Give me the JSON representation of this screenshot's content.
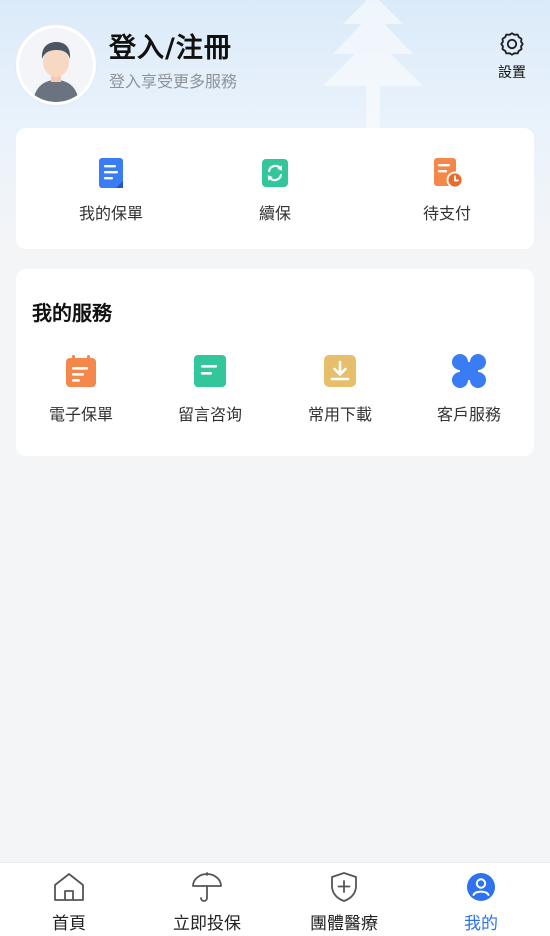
{
  "header": {
    "title": "登入/注冊",
    "subtitle": "登入享受更多服務",
    "settings_label": "設置",
    "settings_icon": "gear-icon",
    "avatar_icon": "avatar"
  },
  "quick_actions": [
    {
      "label": "我的保單",
      "icon": "document-icon",
      "color": "#3a7cf3"
    },
    {
      "label": "續保",
      "icon": "renew-icon",
      "color": "#33c59b"
    },
    {
      "label": "待支付",
      "icon": "pending-payment-icon",
      "color": "#f6874a"
    }
  ],
  "services": {
    "title": "我的服務",
    "items": [
      {
        "label": "電子保單",
        "icon": "e-policy-icon",
        "color": "#f6874a"
      },
      {
        "label": "留言咨询",
        "icon": "message-icon",
        "color": "#33c59b"
      },
      {
        "label": "常用下載",
        "icon": "download-icon",
        "color": "#e6be6c"
      },
      {
        "label": "客戶服務",
        "icon": "grid-icon",
        "color": "#3a7cf3"
      }
    ]
  },
  "tabbar": {
    "items": [
      {
        "label": "首頁",
        "icon": "home-icon",
        "active": false
      },
      {
        "label": "立即投保",
        "icon": "umbrella-icon",
        "active": false
      },
      {
        "label": "團體醫療",
        "icon": "shield-icon",
        "active": false
      },
      {
        "label": "我的",
        "icon": "profile-icon",
        "active": true
      }
    ],
    "active_color": "#2f72ee"
  }
}
